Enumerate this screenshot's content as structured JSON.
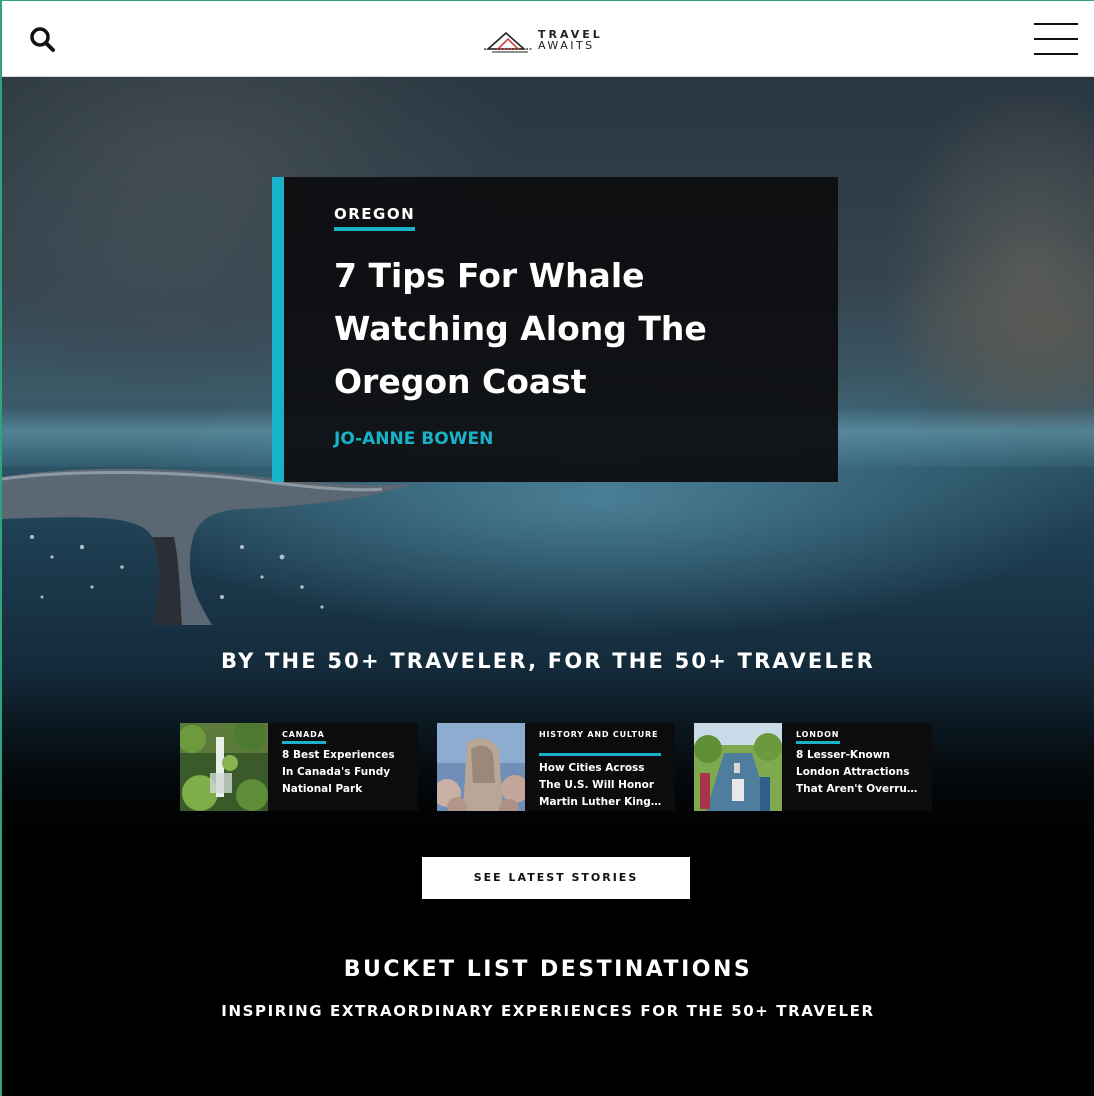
{
  "header": {
    "logo_line1": "TRAVEL",
    "logo_line2": "AWAITS",
    "search_icon": "search-icon",
    "menu_icon": "hamburger-menu-icon"
  },
  "feature": {
    "category": "OREGON",
    "title": "7 Tips For Whale Watching Along The Oregon Coast",
    "author": "JO-ANNE BOWEN",
    "accent_color": "#19b3c9"
  },
  "tagline": "BY THE 50+ TRAVELER, FOR THE 50+ TRAVELER",
  "mini_stories": [
    {
      "category": "CANADA",
      "title_lines": [
        "8 Best Experiences",
        "In Canada's Fundy",
        "National Park"
      ]
    },
    {
      "category": "HISTORY AND CULTURE",
      "title_lines": [
        "How Cities Across",
        "The U.S. Will Honor",
        "Martin Luther King…"
      ]
    },
    {
      "category": "LONDON",
      "title_lines": [
        "8 Lesser-Known",
        "London Attractions",
        "That Aren't Overru…"
      ]
    }
  ],
  "cta_label": "SEE LATEST STORIES",
  "bucket": {
    "title": "BUCKET LIST DESTINATIONS",
    "subtitle": "INSPIRING EXTRAORDINARY EXPERIENCES FOR THE 50+ TRAVELER"
  }
}
